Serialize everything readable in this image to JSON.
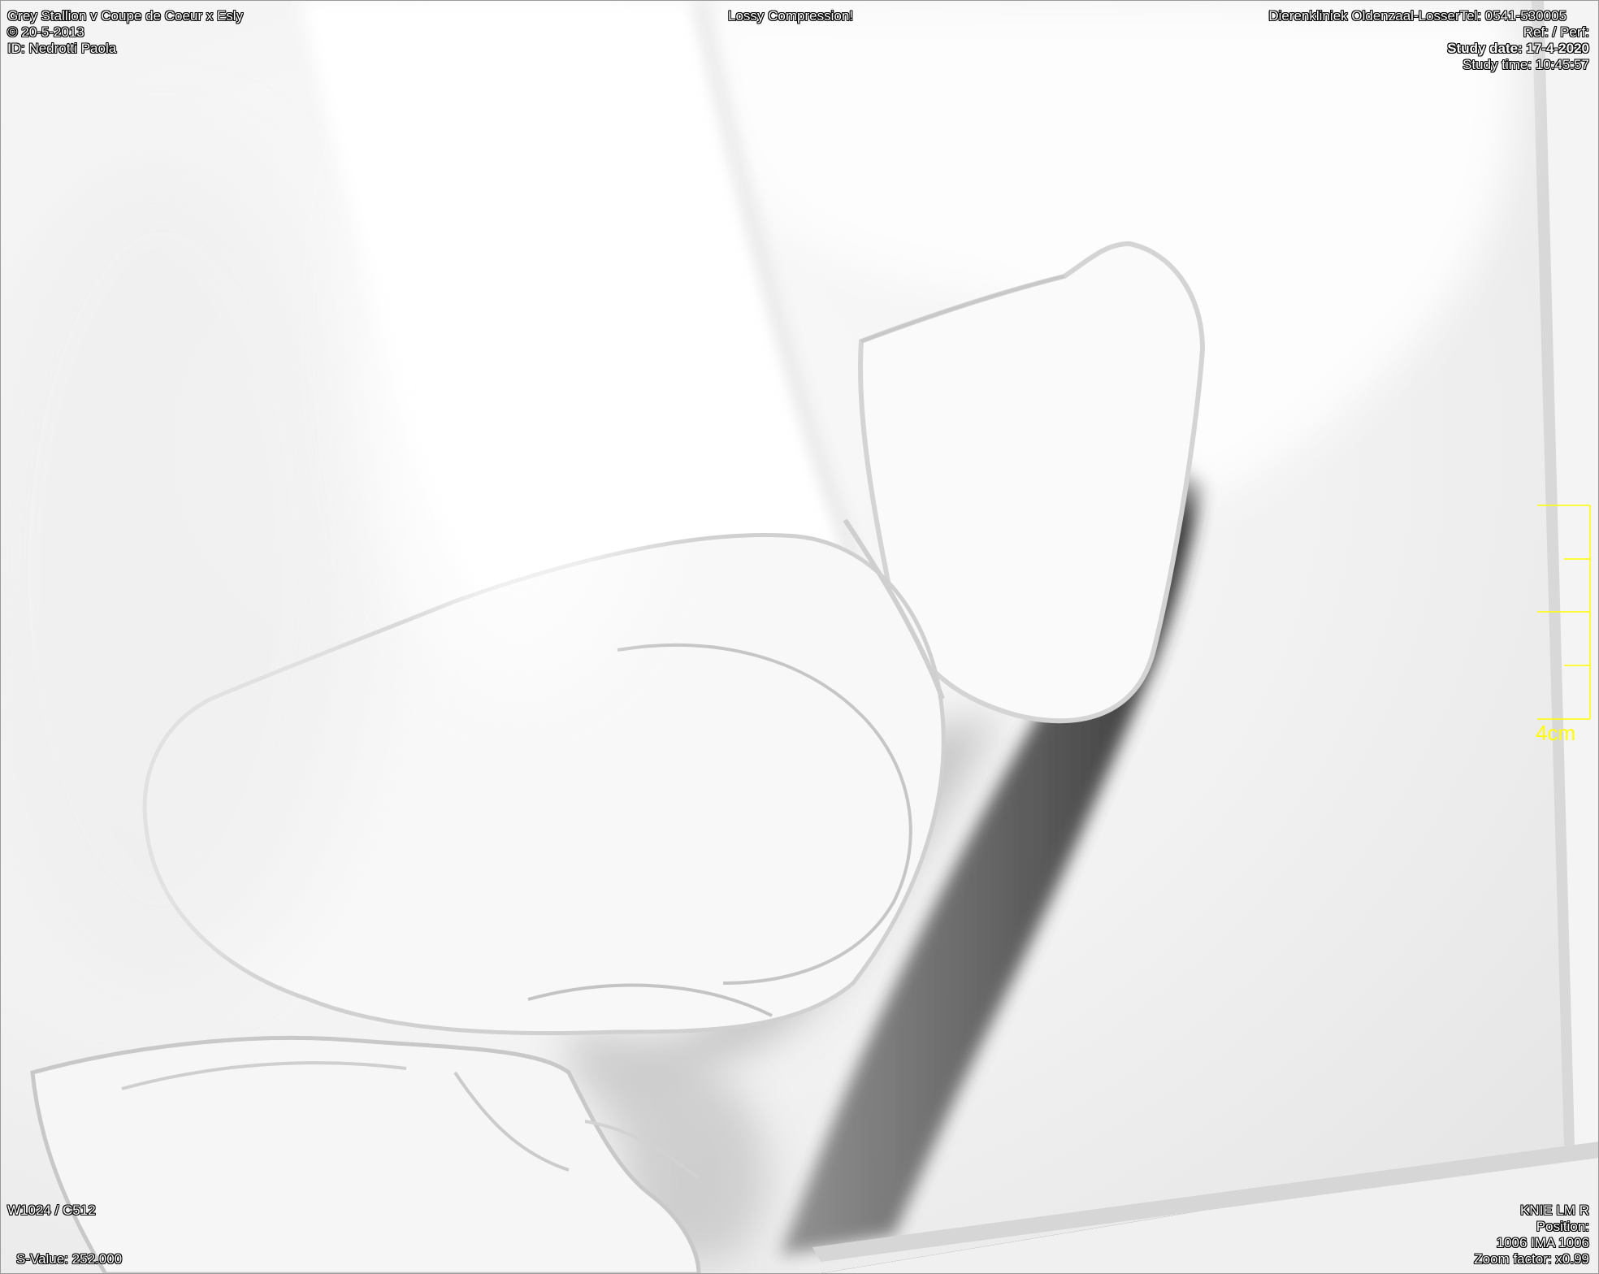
{
  "overlay": {
    "top_left": {
      "patient_line": "Grey Stallion v  Coupe de Coeur x Esly",
      "birth_line": "©  20-5-2013",
      "id_line": "ID: Nedrotti Paola"
    },
    "top_center": {
      "compression_notice": "Lossy Compression!"
    },
    "top_right": {
      "clinic_line": "Dierenkliniek Oldenzaal-LosserTel: 0541-530005",
      "ref_line": "Ref: / Perf:",
      "study_date_line": "Study date: 17-4-2020",
      "study_time_line": "Study time: 10:45:57"
    },
    "bottom_left": {
      "window_level": "W1024 / C512",
      "s_value": "S-Value: 252.000"
    },
    "bottom_right": {
      "series_label": "KNIE LM  R",
      "position_label": "Position:",
      "image_numbers": "1006 IMA 1006",
      "zoom_factor": "Zoom factor: x0.99"
    }
  },
  "scale_bar": {
    "label": "4cm",
    "color": "#ffff00"
  }
}
